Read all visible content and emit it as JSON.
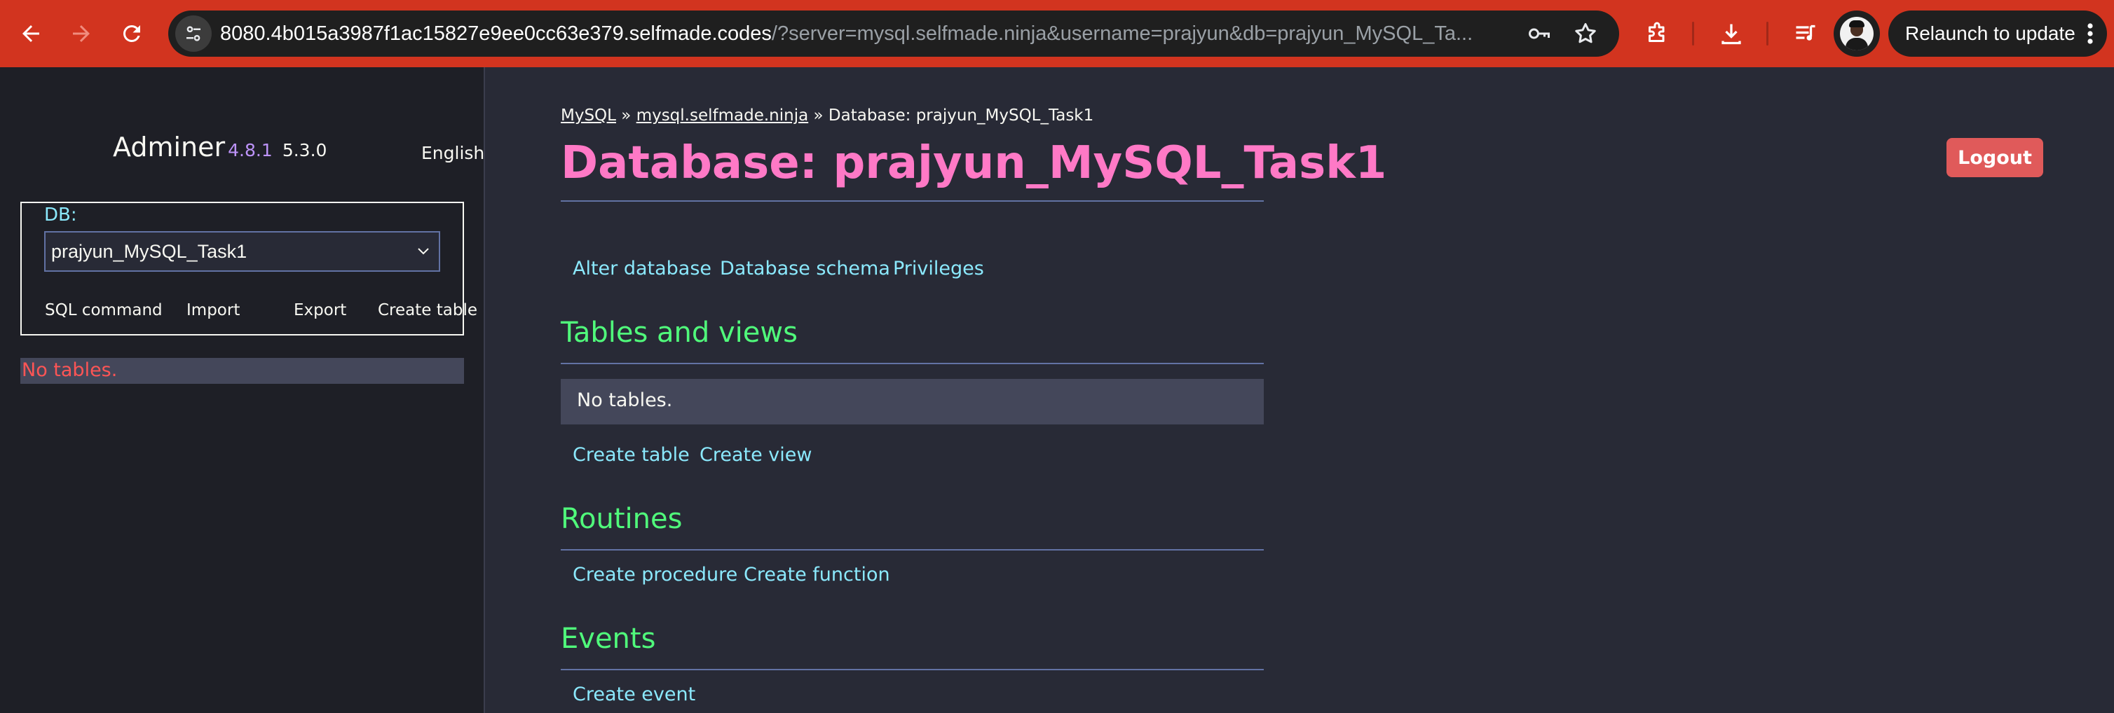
{
  "browser": {
    "url_host": "8080.4b015a3987f1ac15827e9ee0cc63e379.selfmade.codes",
    "url_rest": "/?server=mysql.selfmade.ninja&username=prajyun&db=prajyun_MySQL_Ta...",
    "relaunch_label": "Relaunch to update",
    "chrome_color": "#d2341f",
    "icons": [
      "back-icon",
      "forward-icon",
      "reload-icon",
      "site-info-icon",
      "password-key-icon",
      "bookmark-star-icon",
      "extensions-icon",
      "downloads-icon",
      "media-control-icon",
      "profile-avatar",
      "menu-dots-icon"
    ]
  },
  "sidebar": {
    "app_name": "Adminer",
    "version": "4.8.1",
    "mysql_version": "5.3.0",
    "language": "English",
    "db_label": "DB:",
    "db_selected": "prajyun_MySQL_Task1",
    "links": [
      "SQL command",
      "Import",
      "Export",
      "Create table"
    ],
    "no_tables": "No tables."
  },
  "main": {
    "breadcrumb": {
      "root": "MySQL",
      "sep1": " » ",
      "server": "mysql.selfmade.ninja",
      "sep2": " » ",
      "current": "Database: prajyun_MySQL_Task1"
    },
    "title": "Database: prajyun_MySQL_Task1",
    "logout_label": "Logout",
    "db_actions": [
      "Alter database",
      "Database schema",
      "Privileges"
    ],
    "tables_heading": "Tables and views",
    "tables_empty": "No tables.",
    "table_actions": [
      "Create table",
      "Create view"
    ],
    "routines_heading": "Routines",
    "routine_actions": [
      "Create procedure",
      "Create function"
    ],
    "events_heading": "Events",
    "event_actions": [
      "Create event"
    ]
  },
  "colors": {
    "accent_title": "#ff79c6",
    "heading": "#50fa7b",
    "link": "#8be9fd",
    "version": "#bd93f9",
    "error": "#ff5555",
    "logout": "#e05a5a",
    "background": "#282a36"
  }
}
